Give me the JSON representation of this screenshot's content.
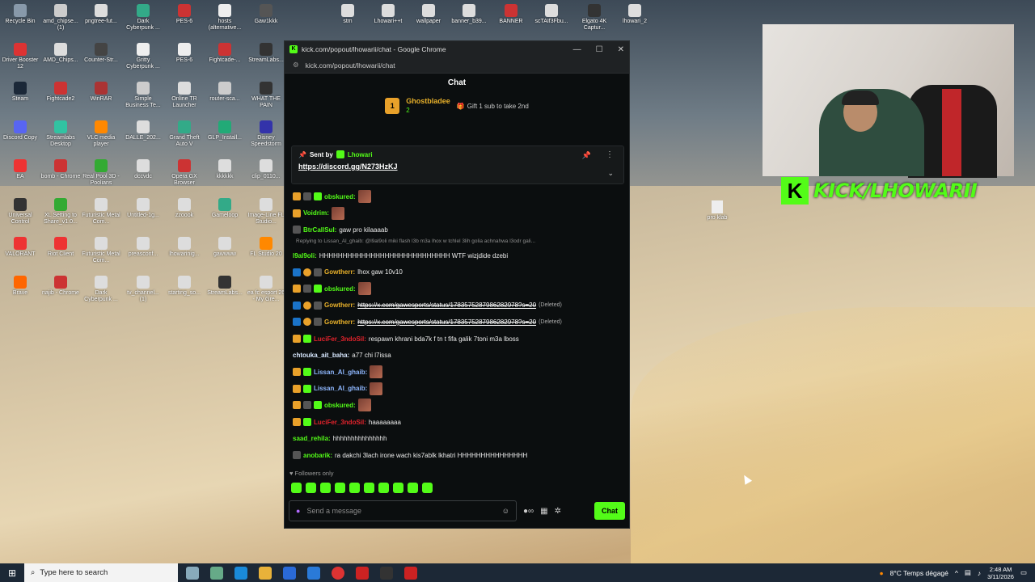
{
  "desktop": {
    "icons": [
      {
        "label": "Recycle Bin",
        "color": "#8899aa"
      },
      {
        "label": "amd_chipse... (1)",
        "color": "#ccc"
      },
      {
        "label": "pngtree-fut...",
        "color": "#ddd"
      },
      {
        "label": "Dark Cyberpunk ...",
        "color": "#3a8"
      },
      {
        "label": "PES-6",
        "color": "#c33"
      },
      {
        "label": "hosts (alternative...",
        "color": "#eee"
      },
      {
        "label": "Gaw1kkk",
        "color": "#555"
      },
      {
        "label": "Driver Booster 12",
        "color": "#d33"
      },
      {
        "label": "AMD_Chips...",
        "color": "#ddd"
      },
      {
        "label": "Counter-Str...",
        "color": "#444"
      },
      {
        "label": "Gritty Cyberpunk ...",
        "color": "#eee"
      },
      {
        "label": "PES-6",
        "color": "#eee"
      },
      {
        "label": "Fightcade-...",
        "color": "#c33"
      },
      {
        "label": "StreamLabs...",
        "color": "#333"
      },
      {
        "label": "Steam",
        "color": "#1b2838"
      },
      {
        "label": "Fightcade2",
        "color": "#c33"
      },
      {
        "label": "WinRAR",
        "color": "#a33"
      },
      {
        "label": "Simple Business Te...",
        "color": "#ccc"
      },
      {
        "label": "Online TR Launcher",
        "color": "#ddd"
      },
      {
        "label": "router-sca...",
        "color": "#ccc"
      },
      {
        "label": "WHAT THE PAIN",
        "color": "#333"
      },
      {
        "label": "Discord Copy",
        "color": "#5865f2"
      },
      {
        "label": "Streamlabs Desktop",
        "color": "#31c3a2"
      },
      {
        "label": "VLC media player",
        "color": "#f80"
      },
      {
        "label": "DALLE_202...",
        "color": "#ddd"
      },
      {
        "label": "Grand Theft Auto V",
        "color": "#3a8"
      },
      {
        "label": "GLP_Install...",
        "color": "#2a7"
      },
      {
        "label": "Disney Speedstorm",
        "color": "#33a"
      },
      {
        "label": "EA",
        "color": "#e33"
      },
      {
        "label": "bomb - Chrome",
        "color": "#c33"
      },
      {
        "label": "Real Pool 3D - Poolians",
        "color": "#3a3"
      },
      {
        "label": "dccvdc",
        "color": "#ddd"
      },
      {
        "label": "Opera GX Browser",
        "color": "#c33"
      },
      {
        "label": "kkkkkk",
        "color": "#ddd"
      },
      {
        "label": "clip_0110...",
        "color": "#ddd"
      },
      {
        "label": "Universal Control",
        "color": "#333"
      },
      {
        "label": "XL Setting to Share_v1.0...",
        "color": "#3a3"
      },
      {
        "label": "Futuristic Metal Com...",
        "color": "#ddd"
      },
      {
        "label": "Untitled-1g...",
        "color": "#ddd"
      },
      {
        "label": "zzoook",
        "color": "#ddd"
      },
      {
        "label": "Gameloop",
        "color": "#3a8"
      },
      {
        "label": "Image-Line FL Studio...",
        "color": "#ddd"
      },
      {
        "label": "VALORANT",
        "color": "#e33"
      },
      {
        "label": "Riot Client",
        "color": "#e33"
      },
      {
        "label": "Futuristic Metal Com...",
        "color": "#ddd"
      },
      {
        "label": "preasconf...",
        "color": "#ddd"
      },
      {
        "label": "lhowarinig...",
        "color": "#ddd"
      },
      {
        "label": "gawwww",
        "color": "#ddd"
      },
      {
        "label": "FL Studio 20",
        "color": "#f80"
      },
      {
        "label": "Brave",
        "color": "#f60"
      },
      {
        "label": "najib - Chrome",
        "color": "#c33"
      },
      {
        "label": "Dark Cyberpunk ...",
        "color": "#ddd"
      },
      {
        "label": "tv_channel... (1)",
        "color": "#ddd"
      },
      {
        "label": "starting_so...",
        "color": "#ddd"
      },
      {
        "label": "StreamLabs...",
        "color": "#333"
      },
      {
        "label": "ea fc esport 26 - My Gre...",
        "color": "#ddd"
      },
      {
        "label": "stm",
        "color": "#ddd"
      },
      {
        "label": "Lhowari++t",
        "color": "#ddd"
      },
      {
        "label": "wallpaper",
        "color": "#ddd"
      },
      {
        "label": "banner_b39...",
        "color": "#ddd"
      },
      {
        "label": "BANNER",
        "color": "#c33"
      },
      {
        "label": "scTAIf3Fbu...",
        "color": "#ddd"
      },
      {
        "label": "Elgato 4K Captur...",
        "color": "#333"
      },
      {
        "label": "lhowari_2",
        "color": "#ddd"
      },
      {
        "label": "pro klab",
        "color": "#ddd"
      }
    ]
  },
  "window": {
    "title": "kick.com/popout/lhowarii/chat - Google Chrome",
    "url": "kick.com/popout/lhowarii/chat"
  },
  "chat": {
    "header": "Chat",
    "top_gifter": {
      "rank": "1",
      "name": "Ghostbladee",
      "count": "2",
      "prompt": "Gift 1 sub to take 2nd"
    },
    "pinned": {
      "sent_by_label": "Sent by",
      "sender": "Lhowari",
      "link": "https://discord.gg/N273HzKJ"
    },
    "messages": [
      {
        "user": "obskured:",
        "color": "green",
        "badges": [
          "crown",
          "og",
          "sub"
        ],
        "text": "",
        "emote": true
      },
      {
        "user": "Voidrim:",
        "color": "green",
        "badges": [
          "crown"
        ],
        "text": "",
        "emote": true
      },
      {
        "user": "BtrCallSul:",
        "color": "green",
        "badges": [
          "og"
        ],
        "text": "gaw pro kilaaaab",
        "emote": false
      },
      {
        "user": "l9al9oli:",
        "color": "green",
        "badges": [],
        "text": "HHHHHHHHHHHHHHHHHHHHHHHHHHHH WTF wizjdide dzebi",
        "emote": false,
        "reply": "Replying to Lissan_Al_ghaib: @l9al9oli miki flash l3b m3a lhox w tchlel 3lih golia achnahwa l3odr gali..."
      },
      {
        "user": "Gowtherr:",
        "color": "gold",
        "badges": [
          "mod",
          "one",
          "og"
        ],
        "text": "lhox gaw 10v10",
        "emote": false
      },
      {
        "user": "obskured:",
        "color": "green",
        "badges": [
          "crown",
          "og",
          "sub"
        ],
        "text": "",
        "emote": true
      },
      {
        "user": "Gowtherr:",
        "color": "gold",
        "badges": [
          "mod",
          "one",
          "og"
        ],
        "text": "",
        "link": "https://x.com/gawesports/status/1783575287986282978?s=20",
        "deleted": "(Deleted)"
      },
      {
        "user": "Gowtherr:",
        "color": "gold",
        "badges": [
          "mod",
          "one",
          "og"
        ],
        "text": "",
        "link": "https://x.com/gawesports/status/1783575287986282978?s=20",
        "deleted": "(Deleted)"
      },
      {
        "user": "LuciFer_3ndoSil:",
        "color": "red",
        "badges": [
          "crown",
          "sub"
        ],
        "text": "respawn khrani bda7k f tn t fifa galik 7toni m3a lboss",
        "emote": false
      },
      {
        "user": "chtouka_ait_baha:",
        "color": "white",
        "badges": [],
        "text": "a77 chi l7issa",
        "emote": false
      },
      {
        "user": "Lissan_Al_ghaib:",
        "color": "blue",
        "badges": [
          "crown",
          "sub"
        ],
        "text": "",
        "emote": true
      },
      {
        "user": "Lissan_Al_ghaib:",
        "color": "blue",
        "badges": [
          "crown",
          "sub"
        ],
        "text": "",
        "emote": true
      },
      {
        "user": "obskured:",
        "color": "green",
        "badges": [
          "crown",
          "og",
          "sub"
        ],
        "text": "",
        "emote": true
      },
      {
        "user": "LuciFer_3ndoSil:",
        "color": "red",
        "badges": [
          "crown",
          "sub"
        ],
        "text": "haaaaaaaa",
        "emote": false
      },
      {
        "user": "saad_rehila:",
        "color": "green",
        "badges": [],
        "text": "hhhhhhhhhhhhhhh",
        "emote": false
      },
      {
        "user": "anobarik:",
        "color": "green",
        "badges": [
          "og"
        ],
        "text": "ra dakchi 3lach irone wach kis7ablk lkhatri HHHHHHHHHHHHHHH",
        "emote": false
      }
    ],
    "followers_only": "Followers only",
    "input_placeholder": "Send a message",
    "send_label": "Chat"
  },
  "overlay": {
    "kick_handle": "KICK/LHOWARII",
    "k_logo": "K"
  },
  "taskbar": {
    "search_placeholder": "Type here to search",
    "weather": "8°C  Temps dégagé",
    "time": "2:48 AM",
    "date": "3/11/2026"
  },
  "colors": {
    "kick_green": "#53fc18",
    "gold": "#e9b12a"
  }
}
